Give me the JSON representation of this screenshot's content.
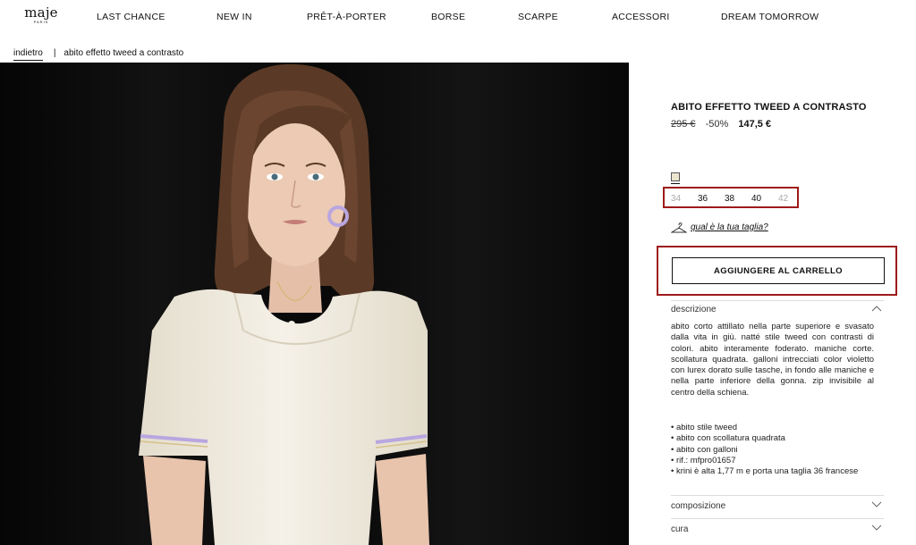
{
  "brand": {
    "logo": "maje",
    "logo_sub": "PARIS"
  },
  "nav": {
    "items": [
      "LAST CHANCE",
      "NEW IN",
      "PRÊT-À-PORTER",
      "BORSE",
      "SCARPE",
      "ACCESSORI",
      "DREAM TOMORROW"
    ]
  },
  "breadcrumb": {
    "back": "indietro",
    "separator": "|",
    "current": "abito effetto tweed a contrasto"
  },
  "product": {
    "title": "ABITO EFFETTO TWEED A CONTRASTO",
    "old_price": "295 €",
    "discount": "-50%",
    "price": "147,5 €",
    "swatch_color": "#ece4cf",
    "sizes": [
      {
        "label": "34",
        "available": false
      },
      {
        "label": "36",
        "available": true
      },
      {
        "label": "38",
        "available": true
      },
      {
        "label": "40",
        "available": true
      },
      {
        "label": "42",
        "available": false
      }
    ],
    "size_guide": "qual è la tua taglia?",
    "add_to_cart": "AGGIUNGERE AL CARRELLO"
  },
  "accordion": {
    "description_title": "descrizione",
    "description_text": "abito corto attillato nella parte superiore e svasato dalla vita in giù. natté stile tweed con contrasti di colori. abito interamente foderato. maniche corte. scollatura quadrata. galloni intrecciati color violetto con lurex dorato sulle tasche, in fondo alle maniche e nella parte inferiore della gonna. zip invisibile al centro della schiena.",
    "bullets": [
      "• abito stile tweed",
      "• abito con scollatura quadrata",
      "• abito con galloni",
      "• rif.: mfpro01657",
      "• krini è alta 1,77 m e porta una taglia 36 francese"
    ],
    "composition_title": "composizione",
    "care_title": "cura"
  },
  "colors": {
    "highlight": "#9e1b1b",
    "photo_bg": "#0b0b0b",
    "dress": "#f2ede2",
    "trim": "#b9a6e0"
  }
}
